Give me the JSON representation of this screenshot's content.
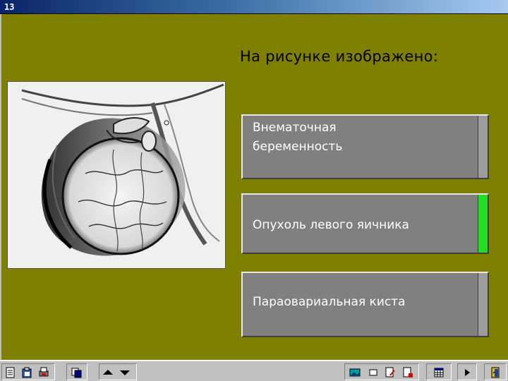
{
  "window": {
    "title": "13"
  },
  "question": {
    "text": "На рисунке изображено:"
  },
  "answers": [
    {
      "label": "Внематочная\nбеременность",
      "state": "neutral"
    },
    {
      "label": "Опухоль левого яичника",
      "state": "correct"
    },
    {
      "label": "Параовариальная киста",
      "state": "neutral"
    }
  ],
  "colors": {
    "background": "#808000",
    "answer_bg": "#808080",
    "correct_indicator": "#22dd22",
    "title_bar": "#0a246a"
  },
  "toolbar": {
    "icons_left": [
      "document-icon",
      "clipboard-icon",
      "printer-icon",
      "cards-icon",
      "arrow-up-icon",
      "arrow-down-icon"
    ],
    "icons_right": [
      "picture-icon",
      "square-icon",
      "edit-page-icon",
      "check-page-icon",
      "calculator-icon",
      "play-icon",
      "exit-door-icon"
    ]
  }
}
